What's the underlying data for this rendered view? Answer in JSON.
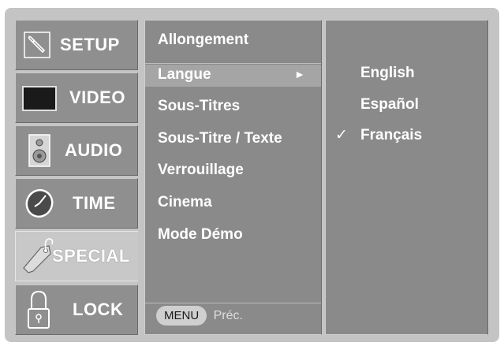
{
  "tabs": [
    {
      "label": "SETUP",
      "icon": "wrench-icon"
    },
    {
      "label": "VIDEO",
      "icon": "screen-icon"
    },
    {
      "label": "AUDIO",
      "icon": "speaker-icon"
    },
    {
      "label": "TIME",
      "icon": "clock-icon"
    },
    {
      "label": "SPECIAL",
      "icon": "tag-icon"
    },
    {
      "label": "LOCK",
      "icon": "padlock-icon"
    }
  ],
  "active_tab": "SPECIAL",
  "menu": {
    "items": [
      "Allongement",
      "Langue",
      "Sous-Titres",
      "Sous-Titre / Texte",
      "Verrouillage",
      "Cinema",
      "Mode Démo"
    ],
    "selected": "Langue",
    "arrow": "►"
  },
  "footer": {
    "menu_label": "MENU",
    "back_label": "Préc."
  },
  "submenu": {
    "items": [
      "English",
      "Español",
      "Français"
    ],
    "checked": "Français",
    "check_mark": "✓"
  },
  "colors": {
    "panel": "#8a8a8a",
    "highlight": "#a5a5a5",
    "text": "#ffffff"
  }
}
